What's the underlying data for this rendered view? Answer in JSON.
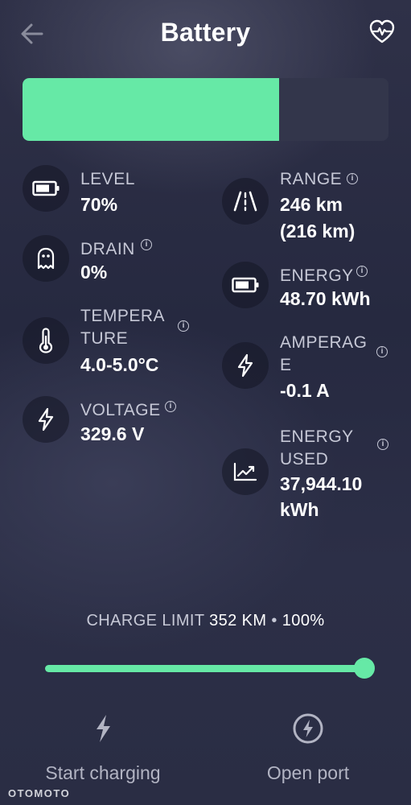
{
  "header": {
    "title": "Battery"
  },
  "battery_bar": {
    "level_fraction": 0.7,
    "fill_color": "#66e9a6"
  },
  "stats": {
    "level": {
      "label": "LEVEL",
      "value": "70%"
    },
    "range": {
      "label": "RANGE",
      "value1": "246 km",
      "value2": "(216 km)"
    },
    "drain": {
      "label": "DRAIN",
      "value": "0%"
    },
    "energy": {
      "label": "ENERGY",
      "value": "48.70 kWh"
    },
    "temperature": {
      "label1": "TEMPERA",
      "label2": "TURE",
      "value": "4.0-5.0°C"
    },
    "amperage": {
      "label1": "AMPERAG",
      "label2": "E",
      "value": "-0.1 A"
    },
    "voltage": {
      "label": "VOLTAGE",
      "value": "329.6 V"
    },
    "energy_used": {
      "label1": "ENERGY",
      "label2": "USED",
      "value1": "37,944.10",
      "value2": "kWh"
    }
  },
  "charge_limit": {
    "label": "CHARGE LIMIT",
    "range": "352 KM",
    "separator": "•",
    "percent": "100%",
    "slider_fraction": 1.0
  },
  "actions": {
    "start_charging": "Start charging",
    "open_port": "Open port"
  },
  "watermark": "OTOMOTO",
  "icons": {
    "back": "arrow-left-icon",
    "health": "heart-pulse-icon",
    "level": "battery-icon",
    "range": "road-icon",
    "drain": "ghost-icon",
    "energy": "battery-icon",
    "temperature": "thermometer-icon",
    "amperage": "bolt-icon",
    "voltage": "bolt-icon",
    "energy_used": "trend-chart-icon",
    "start_charging": "bolt-icon",
    "open_port": "bolt-circle-icon"
  }
}
